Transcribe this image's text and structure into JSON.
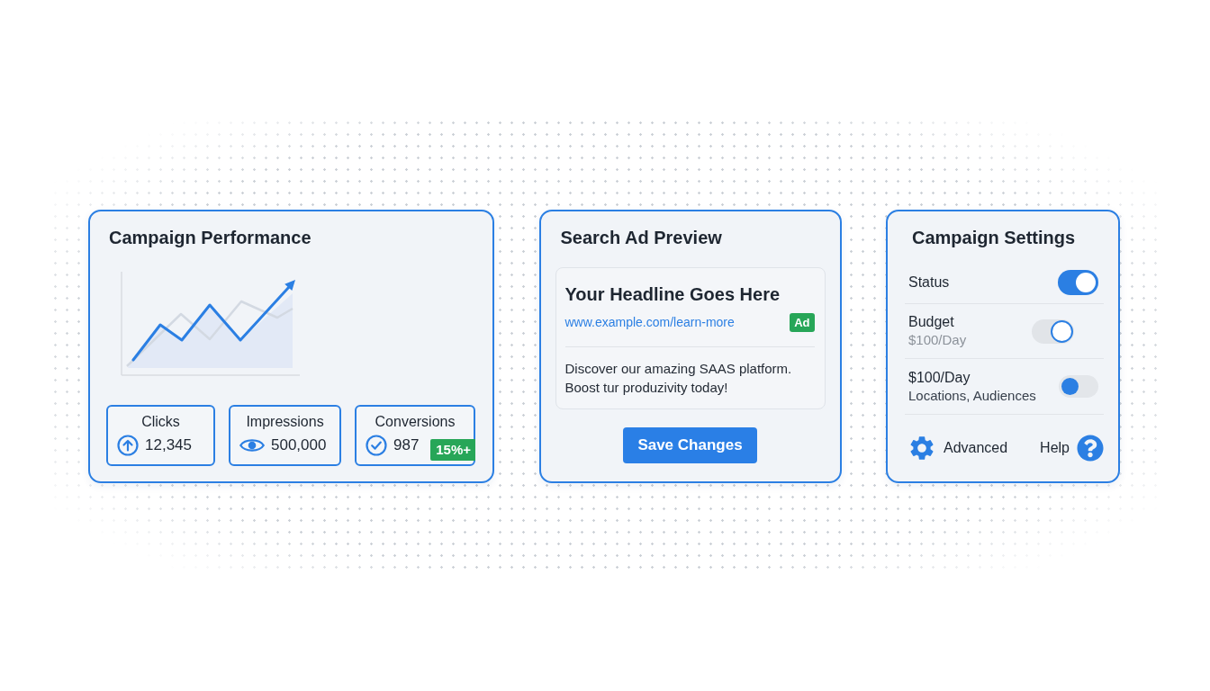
{
  "performance_card": {
    "title": "Campaign Performance",
    "stats": [
      {
        "kind": "clicks",
        "label": "Clicks",
        "value": "12,345"
      },
      {
        "kind": "impressions",
        "label": "Impressions",
        "value": "500,000"
      },
      {
        "kind": "conversions",
        "label": "Conversions",
        "value": "987",
        "badge": "15%+"
      }
    ]
  },
  "ad_preview_card": {
    "title": "Search Ad Preview",
    "ad": {
      "headline": "Your Headline Goes Here",
      "url": "www.example.com/learn-more",
      "badge": "Ad",
      "description": "Discover our amazing SAAS platform. Boost tur produzivity today!"
    },
    "save_button": "Save Changes"
  },
  "settings_card": {
    "title": "Campaign Settings",
    "settings": [
      {
        "label": "Status",
        "toggle": {
          "kind": "solid",
          "on": true
        }
      },
      {
        "label": "Budget",
        "hint": {
          "text": "$100/Day",
          "muted": true
        },
        "toggle": {
          "kind": "ring",
          "on": true
        }
      },
      {
        "label": "$100/Day",
        "hint": {
          "text": "Locations, Audiences",
          "muted": false
        },
        "toggle": {
          "kind": "dot",
          "on": false
        }
      }
    ],
    "links": [
      {
        "kind": "settings",
        "label": "Advanced"
      },
      {
        "kind": "help",
        "label": "Help"
      }
    ]
  }
}
